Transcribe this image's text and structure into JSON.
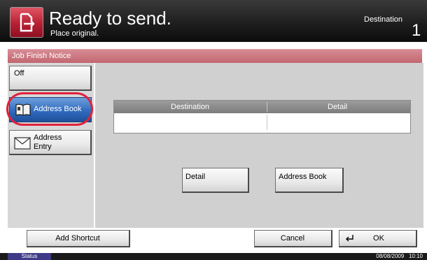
{
  "header": {
    "title": "Ready to send.",
    "subtitle": "Place original.",
    "destination_label": "Destination",
    "destination_count": "1"
  },
  "page": {
    "title": "Job Finish Notice"
  },
  "sidebar": {
    "items": [
      {
        "label": "Off"
      },
      {
        "label": "Address Book"
      },
      {
        "label": "Address Entry"
      }
    ]
  },
  "table": {
    "columns": [
      "Destination",
      "Detail"
    ],
    "rows": []
  },
  "actions": {
    "detail_label": "Detail",
    "address_book_label": "Address Book"
  },
  "footer": {
    "add_shortcut_label": "Add Shortcut",
    "cancel_label": "Cancel",
    "ok_label": "OK"
  },
  "status": {
    "label": "Status",
    "date": "08/08/2009",
    "time": "10:10"
  },
  "colors": {
    "page_bar": "#c1646f",
    "selected": "#2f6bbf",
    "highlight_ring": "#e0223a",
    "header_icon": "#b71f33"
  },
  "icons": [
    "send-icon",
    "address-book-icon",
    "envelope-icon",
    "enter-icon"
  ]
}
